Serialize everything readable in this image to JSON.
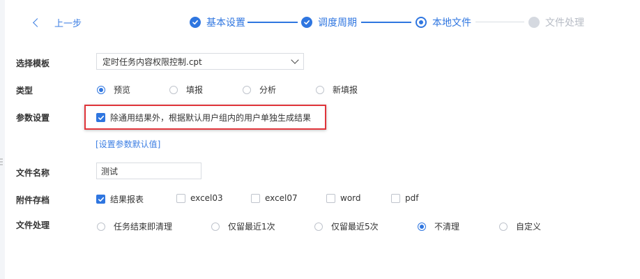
{
  "nav": {
    "back_label": "上一步"
  },
  "steps": [
    {
      "label": "基本设置",
      "state": "done"
    },
    {
      "label": "调度周期",
      "state": "done"
    },
    {
      "label": "本地文件",
      "state": "current"
    },
    {
      "label": "文件处理",
      "state": "pending"
    }
  ],
  "form": {
    "template": {
      "label": "选择模板",
      "value": "定时任务内容权限控制.cpt"
    },
    "type": {
      "label": "类型",
      "options": [
        "预览",
        "填报",
        "分析",
        "新填报"
      ],
      "selected": "预览"
    },
    "params": {
      "label": "参数设置",
      "checkbox_label": "除通用结果外，根据默认用户组内的用户单独生成结果",
      "checked": true,
      "link_label": "[设置参数默认值]"
    },
    "filename": {
      "label": "文件名称",
      "value": "测试"
    },
    "attachments": {
      "label": "附件存档",
      "options": [
        {
          "label": "结果报表",
          "checked": true
        },
        {
          "label": "excel03",
          "checked": false
        },
        {
          "label": "excel07",
          "checked": false
        },
        {
          "label": "word",
          "checked": false
        },
        {
          "label": "pdf",
          "checked": false
        }
      ]
    },
    "file_processing": {
      "label": "文件处理",
      "options": [
        "任务结束即清理",
        "仅留最近1次",
        "仅留最近5次",
        "不清理",
        "自定义"
      ],
      "selected": "不清理"
    }
  },
  "colors": {
    "primary": "#2f76e0",
    "highlight": "#e0343a",
    "pending": "#d5d9e0"
  }
}
